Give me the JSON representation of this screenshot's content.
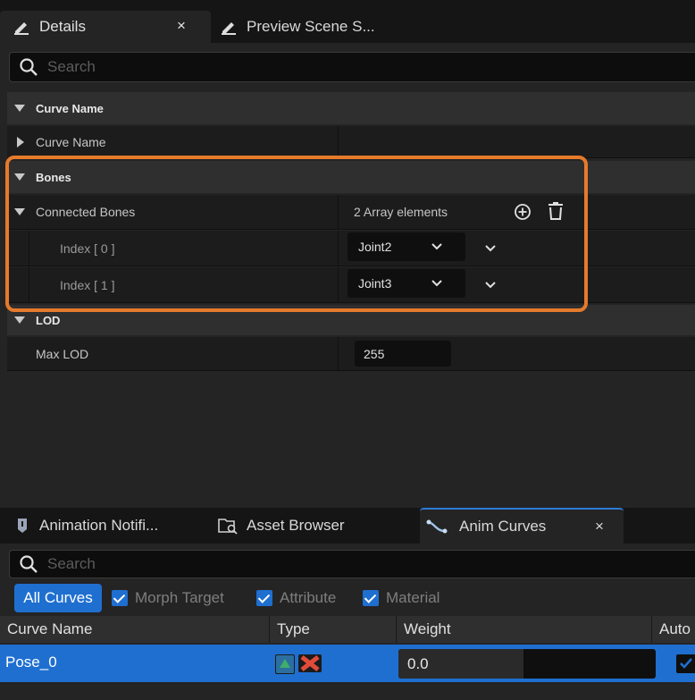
{
  "top_tabs": [
    {
      "label": "Details",
      "close": "×"
    },
    {
      "label": "Preview Scene S..."
    }
  ],
  "details_search": {
    "placeholder": "Search"
  },
  "sections": {
    "curve_name_category": "Curve Name",
    "curve_name_prop": "Curve Name",
    "bones_category": "Bones",
    "connected_bones": {
      "label": "Connected Bones",
      "count_text": "2 Array elements"
    },
    "indices": [
      {
        "label": "Index [ 0 ]",
        "value": "Joint2"
      },
      {
        "label": "Index [ 1 ]",
        "value": "Joint3"
      }
    ],
    "lod_category": "LOD",
    "max_lod": {
      "label": "Max LOD",
      "value": "255"
    }
  },
  "bottom_tabs": [
    {
      "label": "Animation Notifi..."
    },
    {
      "label": "Asset Browser"
    },
    {
      "label": "Anim Curves",
      "close": "×"
    }
  ],
  "curves_search": {
    "placeholder": "Search"
  },
  "filters": {
    "all": "All Curves",
    "checks": [
      "Morph Target",
      "Attribute",
      "Material"
    ]
  },
  "table": {
    "headers": [
      "Curve Name",
      "Type",
      "Weight",
      "Auto"
    ],
    "rows": [
      {
        "name": "Pose_0",
        "weight": "0.0"
      }
    ]
  },
  "colors": {
    "accent": "#1f6fd0",
    "highlight": "#e57a2b"
  }
}
